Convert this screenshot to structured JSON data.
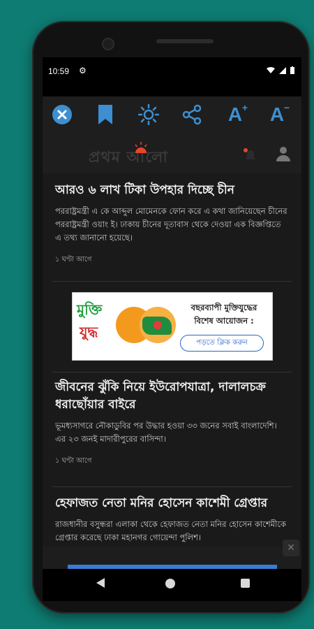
{
  "status_bar": {
    "time": "10:59",
    "settings_icon": "gear-icon"
  },
  "toolbar": {
    "icons": [
      "close-icon",
      "bookmark-icon",
      "brightness-icon",
      "share-icon",
      "font-increase-icon",
      "font-decrease-icon"
    ],
    "accent_color": "#3d8fd1",
    "font_increase_label": "A",
    "font_decrease_label": "A"
  },
  "header": {
    "logo_text": "প্রথম আলো"
  },
  "articles": [
    {
      "title": "আরও ৬ লাখ টিকা উপহার দিচ্ছে চীন",
      "description": "পররাষ্ট্রমন্ত্রী এ কে আব্দুল মোমেনকে ফোন করে এ কথা জানিয়েছেন চীনের পররাষ্ট্রমন্ত্রী ওয়াং ই। ঢাকায় চীনের দূতাবাস থেকে দেওয়া এক বিজ্ঞপ্তিতে এ তথ্য জানানো হয়েছে।",
      "time": "১ ঘণ্টা আগে"
    },
    {
      "title": "জীবনের ঝুঁকি নিয়ে ইউরোপযাত্রা, দালালচক্র ধরাছোঁয়ার বাইরে",
      "description": "ভূমধ্যসাগরে নৌকাডুবির পর উদ্ধার হওয়া ৩৩ জনের সবাই বাংলাদেশি। এর ২৩ জনই মাদারীপুরের বাসিন্দা।",
      "time": "১ ঘণ্টা আগে"
    },
    {
      "title": "হেফাজত নেতা মনির হোসেন কাশেমী গ্রেপ্তার",
      "description": "রাজধানীর বসুন্ধরা এলাকা থেকে হেফাজত নেতা মনির হোসেন কাশেমীকে গ্রেপ্তার করেছে ঢাকা মহানগর গোয়েন্দা পুলিশ।"
    }
  ],
  "ad": {
    "logo_line1": "মুক্তি",
    "logo_line2": "যুদ্ধ",
    "text_line1": "বছরব্যাপী মুক্তিযুদ্ধের",
    "text_line2": "বিশেষ আয়োজন :",
    "button_label": "পড়তে ক্লিক করুন"
  },
  "nav": {
    "back_icon": "back-icon",
    "home_icon": "home-icon",
    "recent_icon": "recent-apps-icon"
  }
}
